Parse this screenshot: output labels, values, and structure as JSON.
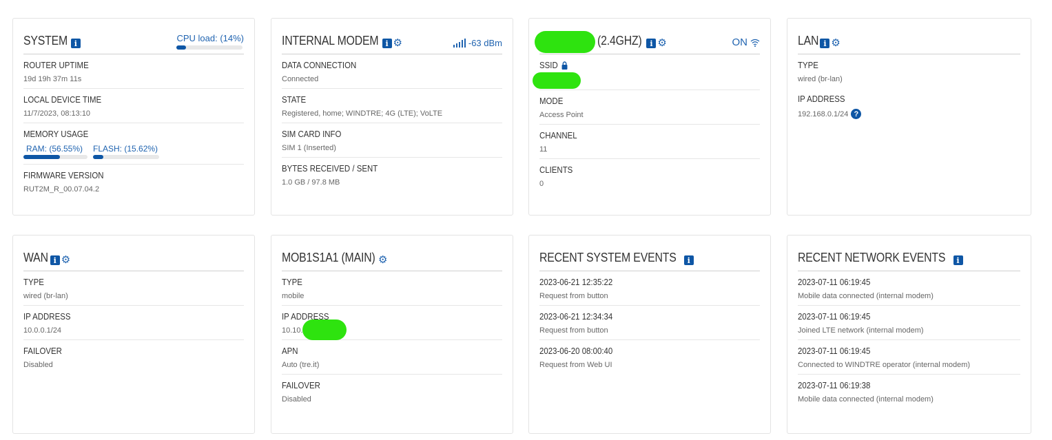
{
  "system": {
    "title": "SYSTEM",
    "cpu_label": "CPU load: (14%)",
    "cpu_percent": 14,
    "uptime_label": "ROUTER UPTIME",
    "uptime_value": "19d 19h 37m 11s",
    "time_label": "LOCAL DEVICE TIME",
    "time_value": "11/7/2023, 08:13:10",
    "memory_label": "MEMORY USAGE",
    "ram_label": "RAM: (56.55%)",
    "ram_percent": 56.55,
    "flash_label": "FLASH: (15.62%)",
    "flash_percent": 15.62,
    "firmware_label": "FIRMWARE VERSION",
    "firmware_value": "RUT2M_R_00.07.04.2"
  },
  "modem": {
    "title": "INTERNAL MODEM",
    "signal": "-63 dBm",
    "data_label": "DATA CONNECTION",
    "data_value": "Connected",
    "state_label": "STATE",
    "state_value": "Registered, home; WINDTRE; 4G (LTE); VoLTE",
    "sim_label": "SIM CARD INFO",
    "sim_value": "SIM 1 (Inserted)",
    "bytes_label": "BYTES RECEIVED / SENT",
    "bytes_value": "1.0 GB / 97.8 MB"
  },
  "wifi": {
    "title": "(2.4GHZ)",
    "status": "ON",
    "ssid_label": "SSID",
    "mode_label": "MODE",
    "mode_value": "Access Point",
    "channel_label": "CHANNEL",
    "channel_value": "11",
    "clients_label": "CLIENTS",
    "clients_value": "0"
  },
  "lan": {
    "title": "LAN",
    "type_label": "TYPE",
    "type_value": "wired (br-lan)",
    "ip_label": "IP ADDRESS",
    "ip_value": "192.168.0.1/24"
  },
  "wan": {
    "title": "WAN",
    "type_label": "TYPE",
    "type_value": "wired (br-lan)",
    "ip_label": "IP ADDRESS",
    "ip_value": "10.0.0.1/24",
    "failover_label": "FAILOVER",
    "failover_value": "Disabled"
  },
  "mob": {
    "title": "MOB1S1A1 (MAIN)",
    "type_label": "TYPE",
    "type_value": "mobile",
    "ip_label": "IP ADDRESS",
    "ip_value": "10.10.",
    "apn_label": "APN",
    "apn_value": "Auto (tre.it)",
    "failover_label": "FAILOVER",
    "failover_value": "Disabled"
  },
  "sys_events": {
    "title": "RECENT SYSTEM EVENTS",
    "items": [
      {
        "time": "2023-06-21 12:35:22",
        "text": "Request from button"
      },
      {
        "time": "2023-06-21 12:34:34",
        "text": "Request from button"
      },
      {
        "time": "2023-06-20 08:00:40",
        "text": "Request from Web UI"
      }
    ]
  },
  "net_events": {
    "title": "RECENT NETWORK EVENTS",
    "items": [
      {
        "time": "2023-07-11 06:19:45",
        "text": "Mobile data connected (internal modem)"
      },
      {
        "time": "2023-07-11 06:19:45",
        "text": "Joined LTE network (internal modem)"
      },
      {
        "time": "2023-07-11 06:19:45",
        "text": "Connected to WINDTRE operator (internal modem)"
      },
      {
        "time": "2023-07-11 06:19:38",
        "text": "Mobile data connected (internal modem)"
      }
    ]
  },
  "colors": {
    "accent": "#0e56a5",
    "redaction": "#2ee30f"
  },
  "icons": [
    "info-icon",
    "gear-icon",
    "signal-icon",
    "wifi-icon",
    "lock-icon",
    "help-icon"
  ]
}
